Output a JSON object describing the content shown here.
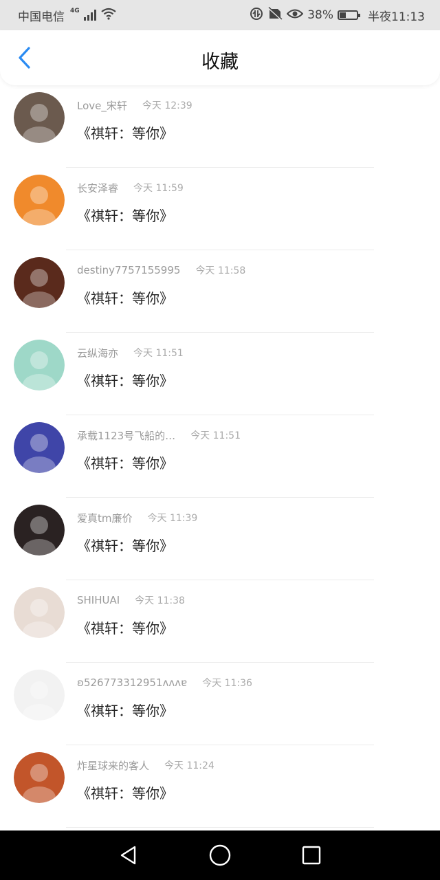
{
  "status_bar": {
    "carrier": "中国电信",
    "network": "4G",
    "battery": "38%",
    "battery_level": 0.38,
    "time": "半夜11:13"
  },
  "header": {
    "title": "收藏"
  },
  "items": [
    {
      "name": "Love_宋轩",
      "time": "今天 12:39",
      "content": "《祺轩：等你》",
      "avatar_color": "#6b5a4e"
    },
    {
      "name": "长安泽睿",
      "time": "今天 11:59",
      "content": "《祺轩：等你》",
      "avatar_color": "#f08a2c"
    },
    {
      "name": "destiny7757155995",
      "time": "今天 11:58",
      "content": "《祺轩：等你》",
      "avatar_color": "#5a2a1c"
    },
    {
      "name": "云纵海亦",
      "time": "今天 11:51",
      "content": "《祺轩：等你》",
      "avatar_color": "#9ed8c8"
    },
    {
      "name": "承载1123号飞船的…",
      "time": "今天 11:51",
      "content": "《祺轩：等你》",
      "avatar_color": "#3f45a8"
    },
    {
      "name": "爱真tm廉价",
      "time": "今天 11:39",
      "content": "《祺轩：等你》",
      "avatar_color": "#2a2222"
    },
    {
      "name": "SHIHUAI",
      "time": "今天 11:38",
      "content": "《祺轩：等你》",
      "avatar_color": "#e8dcd4"
    },
    {
      "name": "ʚ526773312951ʌʌʌɐ",
      "time": "今天 11:36",
      "content": "《祺轩：等你》",
      "avatar_color": "#f2f2f2"
    },
    {
      "name": "炸星球来的客人",
      "time": "今天 11:24",
      "content": "《祺轩：等你》",
      "avatar_color": "#c2552a"
    }
  ]
}
